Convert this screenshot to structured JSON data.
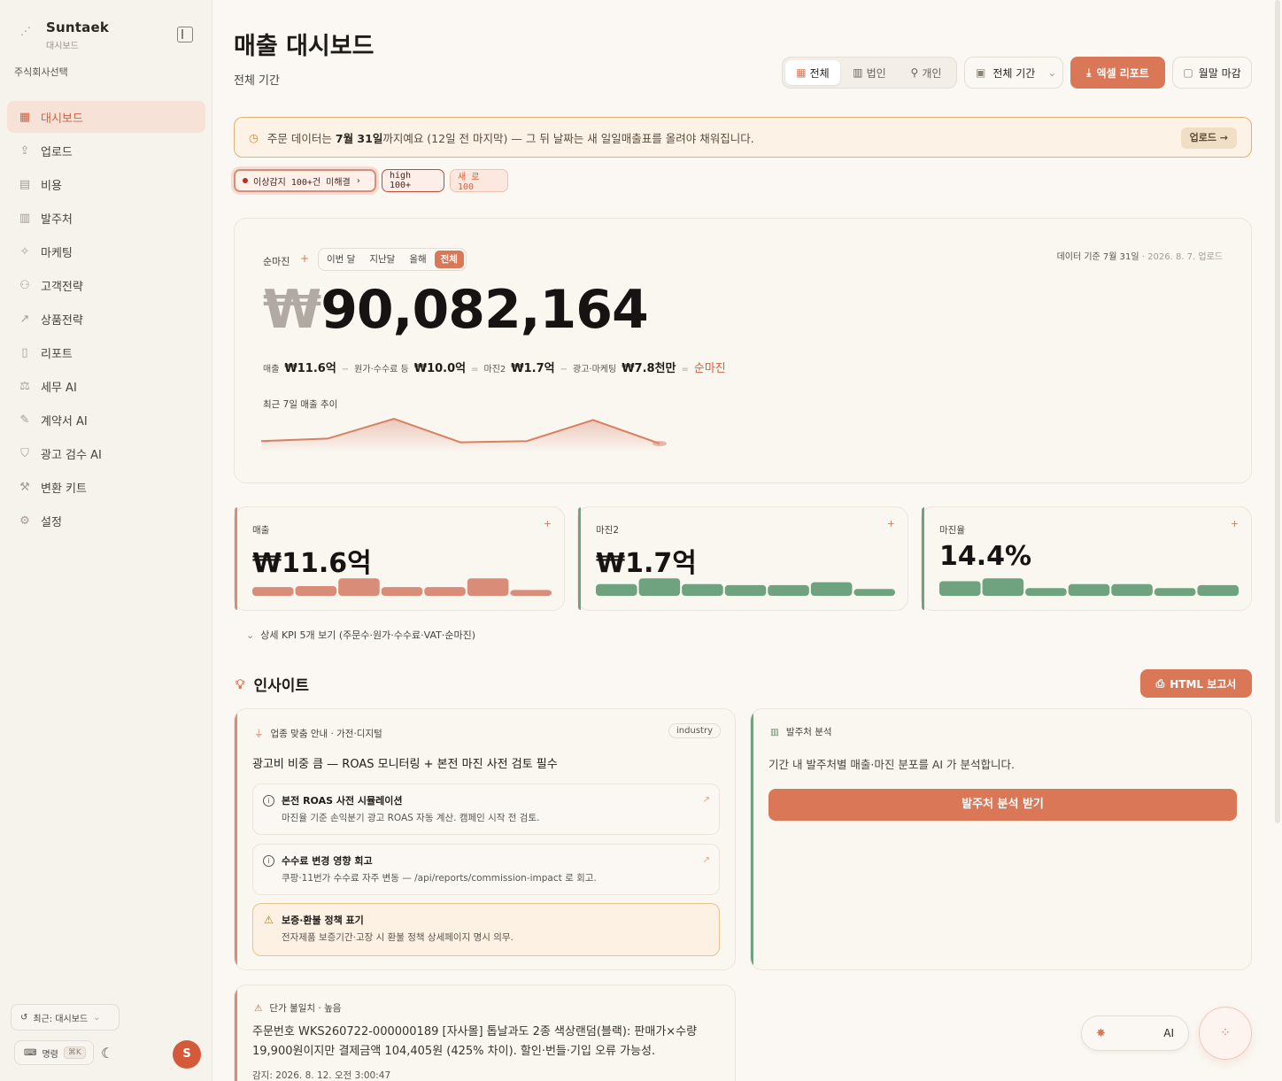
{
  "sidebar": {
    "brand_name": "Suntaek",
    "brand_sub": "대시보드",
    "company": "주식회사선택",
    "items": [
      {
        "label": "대시보드",
        "icon": "grid-icon",
        "active": true
      },
      {
        "label": "업로드",
        "icon": "upload-icon"
      },
      {
        "label": "비용",
        "icon": "receipt-icon"
      },
      {
        "label": "발주처",
        "icon": "building-icon"
      },
      {
        "label": "마케팅",
        "icon": "sparkle-icon"
      },
      {
        "label": "고객전략",
        "icon": "users-icon"
      },
      {
        "label": "상품전략",
        "icon": "trend-icon"
      },
      {
        "label": "리포트",
        "icon": "document-icon"
      },
      {
        "label": "세무 AI",
        "icon": "scale-icon"
      },
      {
        "label": "계약서 AI",
        "icon": "contract-icon"
      },
      {
        "label": "광고 검수 AI",
        "icon": "shield-icon"
      },
      {
        "label": "변환 키트",
        "icon": "wrench-icon"
      },
      {
        "label": "설정",
        "icon": "gear-icon"
      }
    ],
    "recent_label": "최근: 대시보드",
    "command_label": "명령",
    "command_shortcut": "⌘K",
    "avatar_initial": "S"
  },
  "header": {
    "title": "매출 대시보드",
    "subtitle": "전체 기간",
    "segments": [
      "전체",
      "법인",
      "개인"
    ],
    "period_label": "전체 기간",
    "excel_label": "엑셀 리포트",
    "monthly_label": "월말 마감"
  },
  "banner": {
    "prefix": "주문 데이터는 ",
    "date": "7월 31일",
    "suffix": "까지예요 (12일 전 마지막) — 그 뒤 날짜는 새 일일매출표를 올려야 채워집니다.",
    "button": "업로드 →"
  },
  "alerts": {
    "anomaly": "이상감지 100+건 미해결",
    "high": "high 100+",
    "new": "새 로 100"
  },
  "hero": {
    "label": "순마진",
    "tabs": [
      "이번 달",
      "지난달",
      "올해",
      "전체"
    ],
    "active_tab": "전체",
    "meta": "데이터 기준 7월 31일",
    "meta_sub": "· 2026. 8. 7. 업로드",
    "currency": "₩",
    "value": "90,082,164",
    "formula": [
      {
        "label": "매출",
        "value": "₩11.6억"
      },
      {
        "op": "−"
      },
      {
        "label": "원가·수수료 등",
        "value": "₩10.0억"
      },
      {
        "op": "="
      },
      {
        "label": "마진2",
        "value": "₩1.7억"
      },
      {
        "op": "−"
      },
      {
        "label": "광고·마케팅",
        "value": "₩7.8천만"
      },
      {
        "op": "="
      }
    ],
    "result": "순마진",
    "spark_label": "최근 7일 매출 추이",
    "spark_values": [
      0.1,
      0.2,
      1.0,
      0.05,
      0.1,
      0.95,
      0.0
    ]
  },
  "kpis": [
    {
      "label": "매출",
      "value": "₩11.6억",
      "color": "#d98d78",
      "bars": [
        0.45,
        0.5,
        0.9,
        0.45,
        0.45,
        0.9,
        0.3
      ]
    },
    {
      "label": "마진2",
      "value": "₩1.7억",
      "color": "#6fa27e",
      "bars": [
        0.6,
        0.9,
        0.6,
        0.55,
        0.55,
        0.7,
        0.35
      ]
    },
    {
      "label": "마진율",
      "value": "14.4%",
      "color": "#6fa27e",
      "bars": [
        0.75,
        0.9,
        0.4,
        0.6,
        0.6,
        0.4,
        0.55
      ]
    }
  ],
  "detail_toggle": "상세 KPI 5개 보기 (주문수·원가·수수료·VAT·순마진)",
  "insights": {
    "title": "인사이트",
    "html_button": "HTML 보고서",
    "industry": {
      "head": "업종 맞춤 안내 · 가전·디지털",
      "tag": "industry",
      "title": "광고비 비중 큼 — ROAS 모니터링 + 본전 마진 사전 검토 필수",
      "items": [
        {
          "title": "본전 ROAS 사전 시뮬레이션",
          "desc": "마진율 기준 손익분기 광고 ROAS 자동 계산. 캠페인 시작 전 검토."
        },
        {
          "title": "수수료 변경 영향 회고",
          "desc": "쿠팡·11번가 수수료 자주 변동 — /api/reports/commission-impact 로 회고."
        },
        {
          "title": "보증·환불 정책 표기",
          "desc": "전자제품 보증기간·고장 시 환불 정책 상세페이지 명시 의무."
        }
      ]
    },
    "vendor": {
      "head": "발주처 분석",
      "desc": "기간 내 발주처별 매출·마진 분포를 AI 가 분석합니다.",
      "button": "발주처 분석 받기"
    },
    "alert": {
      "head": "단가 불일치 · 높음",
      "body": "주문번호 WKS260722-000000189 [자사몰] 톱날과도 2종 색상랜덤(블랙): 판매가×수량 19,900원이지만 결제금액 104,405원 (425% 차이). 할인·번들·기입 오류 가능성.",
      "time": "감지: 2026. 8. 12. 오전 3:00:47"
    }
  },
  "ai_widget": {
    "label": "AI"
  }
}
